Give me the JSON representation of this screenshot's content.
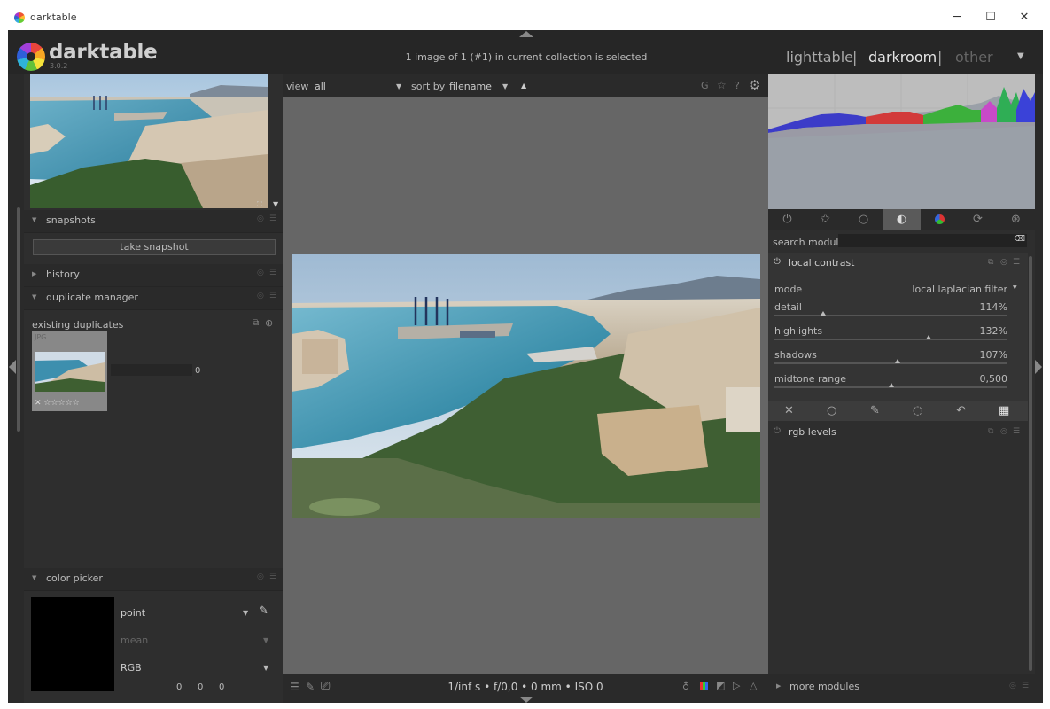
{
  "window": {
    "title": "darktable",
    "minimize": "─",
    "maximize": "☐",
    "close": "✕"
  },
  "header": {
    "logo": "darktable",
    "version": "3.0.2",
    "status": "1 image of 1 (#1) in current collection is selected",
    "views": [
      "lighttable",
      "darkroom",
      "other"
    ],
    "separator": "|",
    "menu_icon": "▼"
  },
  "left": {
    "snapshots": "snapshots",
    "take_snapshot": "take snapshot",
    "history": "history",
    "duplicate_manager": "duplicate manager",
    "existing_duplicates": "existing duplicates",
    "dup_format": "JPG",
    "dup_count": "0",
    "color_picker": "color picker",
    "picker_mode": "point",
    "picker_stat": "mean",
    "picker_space": "RGB",
    "picker_values": [
      "0",
      "0",
      "0"
    ]
  },
  "center": {
    "view_label": "view",
    "view_value": "all",
    "sort_label": "sort by",
    "sort_value": "filename",
    "toolbar_g": "G",
    "exif": "1/inf s • f/0,0 • 0 mm • ISO 0"
  },
  "right": {
    "search_label": "search module",
    "module_title": "local contrast",
    "mode_label": "mode",
    "mode_value": "local laplacian filter",
    "params": [
      {
        "label": "detail",
        "value": "114%",
        "fraction": 0.21
      },
      {
        "label": "highlights",
        "value": "132%",
        "fraction": 0.66
      },
      {
        "label": "shadows",
        "value": "107%",
        "fraction": 0.53
      },
      {
        "label": "midtone range",
        "value": "0,500",
        "fraction": 0.5
      }
    ],
    "rgb_levels": "rgb levels",
    "more_modules": "more modules"
  }
}
